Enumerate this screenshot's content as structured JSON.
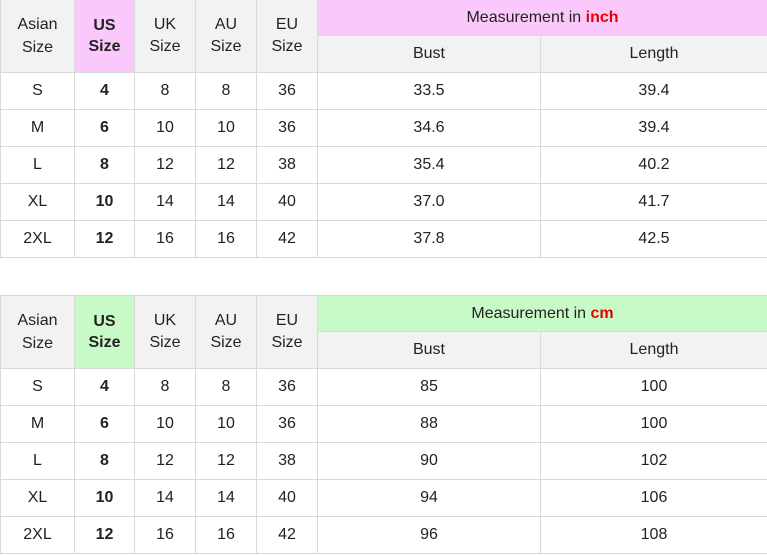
{
  "colors": {
    "inch_header_bg": "#fbc8fb",
    "cm_header_bg": "#c8fac8",
    "unit_color": "#e60000",
    "header_bg": "#f2f2f2",
    "border": "#d9d9d9"
  },
  "headers": {
    "asian": [
      "Asian",
      "Size"
    ],
    "us": [
      "US",
      "Size"
    ],
    "uk": [
      "UK",
      "Size"
    ],
    "au": [
      "AU",
      "Size"
    ],
    "eu": [
      "EU",
      "Size"
    ]
  },
  "tables": [
    {
      "measurement_prefix": "Measurement in ",
      "unit": "inch",
      "col_bust": "Bust",
      "col_length": "Length",
      "rows": [
        {
          "asian": "S",
          "us": "4",
          "uk": "8",
          "au": "8",
          "eu": "36",
          "bust": "33.5",
          "length": "39.4"
        },
        {
          "asian": "M",
          "us": "6",
          "uk": "10",
          "au": "10",
          "eu": "36",
          "bust": "34.6",
          "length": "39.4"
        },
        {
          "asian": "L",
          "us": "8",
          "uk": "12",
          "au": "12",
          "eu": "38",
          "bust": "35.4",
          "length": "40.2"
        },
        {
          "asian": "XL",
          "us": "10",
          "uk": "14",
          "au": "14",
          "eu": "40",
          "bust": "37.0",
          "length": "41.7"
        },
        {
          "asian": "2XL",
          "us": "12",
          "uk": "16",
          "au": "16",
          "eu": "42",
          "bust": "37.8",
          "length": "42.5"
        }
      ]
    },
    {
      "measurement_prefix": "Measurement in ",
      "unit": "cm",
      "col_bust": "Bust",
      "col_length": "Length",
      "rows": [
        {
          "asian": "S",
          "us": "4",
          "uk": "8",
          "au": "8",
          "eu": "36",
          "bust": "85",
          "length": "100"
        },
        {
          "asian": "M",
          "us": "6",
          "uk": "10",
          "au": "10",
          "eu": "36",
          "bust": "88",
          "length": "100"
        },
        {
          "asian": "L",
          "us": "8",
          "uk": "12",
          "au": "12",
          "eu": "38",
          "bust": "90",
          "length": "102"
        },
        {
          "asian": "XL",
          "us": "10",
          "uk": "14",
          "au": "14",
          "eu": "40",
          "bust": "94",
          "length": "106"
        },
        {
          "asian": "2XL",
          "us": "12",
          "uk": "16",
          "au": "16",
          "eu": "42",
          "bust": "96",
          "length": "108"
        }
      ]
    }
  ]
}
